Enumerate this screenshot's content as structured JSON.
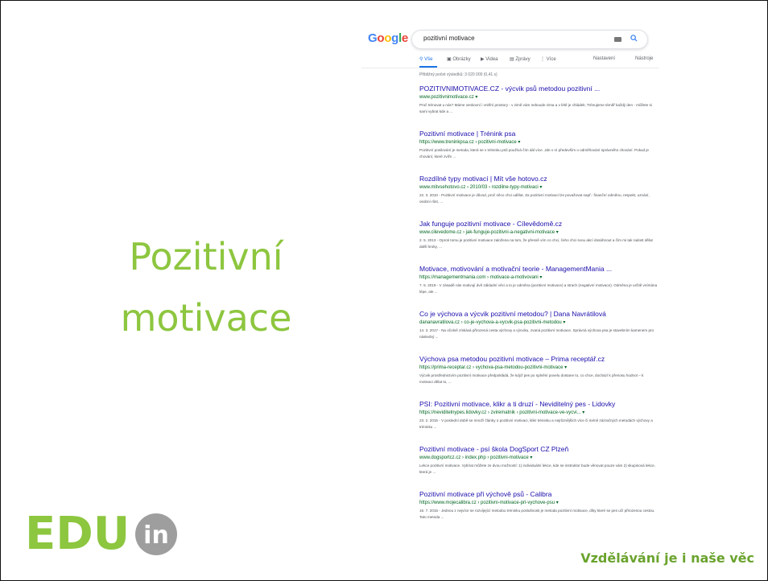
{
  "slide": {
    "title_line1": "Pozitivní",
    "title_line2": "motivace",
    "logo_text": "EDU",
    "logo_badge": "in",
    "tagline": "Vzdělávání je i naše věc"
  },
  "screenshot": {
    "logo_letters": [
      "G",
      "o",
      "o",
      "g",
      "l",
      "e"
    ],
    "logo_colors": [
      "#4285f4",
      "#ea4335",
      "#fbbc05",
      "#4285f4",
      "#34a853",
      "#ea4335"
    ],
    "query": "pozitivní motivace",
    "tabs": [
      "Vše",
      "Obrázky",
      "Videa",
      "Zprávy",
      "Více",
      "Nastavení",
      "Nástroje"
    ],
    "results_count": "Přibližný počet výsledků: 3 020 000 (0,41 s)",
    "results": [
      {
        "title": "POZITIVNIMOTIVACE.CZ - výcvik psů metodou pozitivní ...",
        "url": "www.pozitivnimotivace.cz ▾",
        "snippet": "Proč trénovat u nás? Máme venkovní i vnitřní prostory - v zimě vám neboude zima a v létě je chládek; Trénujeme téměř každý den - můžete si sami vybrat kde a ..."
      },
      {
        "title": "Pozitivní motivace | Trénink psa",
        "url": "https://www.treninkpsa.cz › pozitivni-motivace ▾",
        "snippet": "Pozitivní posilování je metoda, která se v tréninku psů používá čím dál více. Jde v ní především o odměňování správného chování. Pokud je chování, které zvíře ..."
      },
      {
        "title": "Rozdílné typy motivací | Mít vše hotovo.cz",
        "url": "www.mitvsehotovo.cz › 2010/03 › rozdilne-typy-motivaci ▾",
        "snippet": "22. 3. 2010 - Pozitivní motivace je důvod, proč něco chci udělat. Za pozitivní motivaci lze považovat např.: finanční odměnu, respekt, uznání, osobní růst, ..."
      },
      {
        "title": "Jak funguje pozitivní motivace - Cílevědomě.cz",
        "url": "www.cilevedome.cz › jak-funguje-pozitivni-a-negativni-motivace ▾",
        "snippet": "2. 5. 2013 - Oproti tomu je pozitivní motivace založena na tom, že přesně vím co chci, čeho chci svou akcí dosáhnout a čím mi tak radost dělat další kroky, ..."
      },
      {
        "title": "Motivace, motivování a motivační teorie - ManagementMania ...",
        "url": "https://managementmania.com › motivace-a-motivovani ▾",
        "snippet": "7. 5. 2019 - V zásadě nás motivují dvě základní věci a to je odměna (pozitivní motivace) a strach (negativní motivace). Odměna je určitě vnímána lépe, ale ..."
      },
      {
        "title": "Co je výchova a výcvik pozitivní metodou? | Dana Navrátilová",
        "url": "dananavratilova.cz › co-je-vychova-a-vycvik-psa-pozitivni-metodou ▾",
        "snippet": "14. 3. 2017 - Na očolně získává přirozená cesta výchovy a výcviku, zvaná pozitivní motivace. Správná výchova psa je stavebním kamenem pro následný ..."
      },
      {
        "title": "Výchova psa metodou pozitivní motivace – Prima receptář.cz",
        "url": "https://prima-receptar.cz › vychova-psa-metodou-pozitivni-motivace ▾",
        "snippet": "Výcvik prostřednictvím pozitivní motivace předpokládá, že když pes po splnění povelu dostane to, co chce, dochází k přenosu hodnot – k motivaci dělat to, ..."
      },
      {
        "title": "PSI: Pozitivní motivace, klikr a ti druzí - Neviditelný pes - Lidovky",
        "url": "https://neviditelnypes.lidovky.cz › zvirematnik › pozitivni-motivace-ve-vycvi... ▾",
        "snippet": "23. 2. 2015 - V poslední době se množí články o pozitivní motivaci, klikr tréninku a nejrůznějších více či méně zázračných metodách výchovy a tréninku ..."
      },
      {
        "title": "Pozitivní motivace - psí škola DogSport CZ Plzeň",
        "url": "www.dogsportcz.cz › index.php › pozitivni-motivace ▾",
        "snippet": "Lekce pozitivní motivace. Vybírat můžete ze dvou možností: 1) individuální lekce, kde se instruktor bude věnovat pouze vám 2) skupinová lekce, která je ..."
      },
      {
        "title": "Pozitivní motivace při výchově psů - Calibra",
        "url": "https://www.mojecalibra.cz › pozitivni-motivace-pri-vychove-psu ▾",
        "snippet": "16. 7. 2015 - Jednou z nejvíce se rozvíjející metodou tréninku poslušnosti je metoda pozitivní motivace, díky které se pes učí přirozenou cestou. Tato metoda ..."
      }
    ]
  }
}
